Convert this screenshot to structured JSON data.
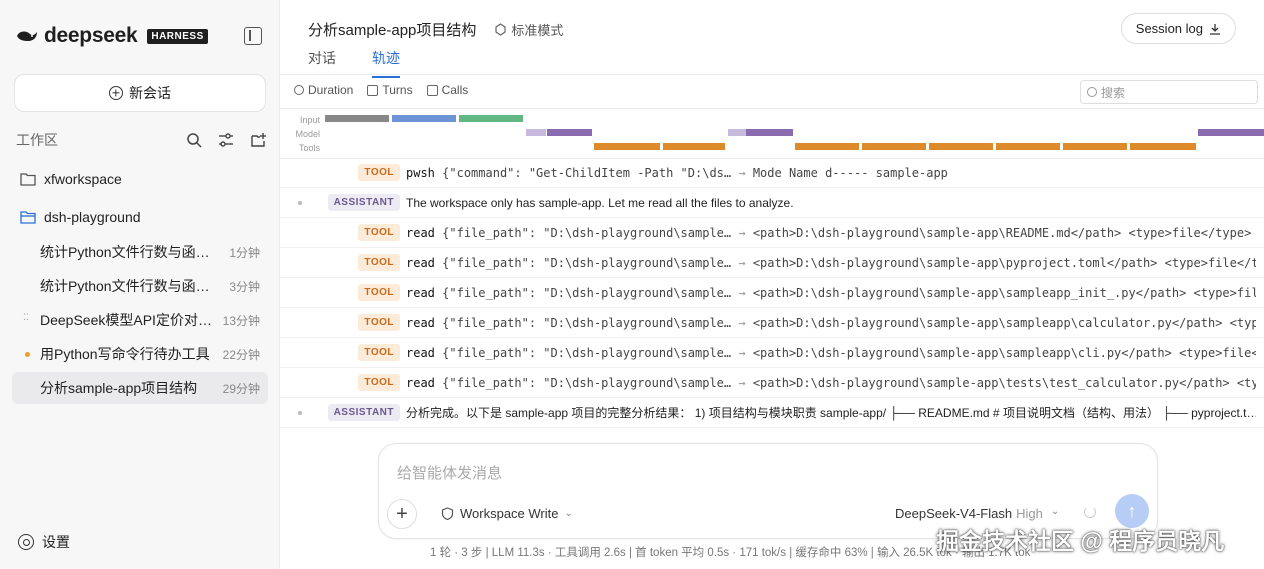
{
  "brand": {
    "name": "deepseek",
    "badge": "HARNESS"
  },
  "sidebar": {
    "new_chat": "新会话",
    "workspace_label": "工作区",
    "folders": [
      "xfworkspace",
      "dsh-playground"
    ],
    "chats": [
      {
        "title": "统计Python文件行数与函数数",
        "time": "1分钟"
      },
      {
        "title": "统计Python文件行数与函数数",
        "time": "3分钟"
      },
      {
        "title": "DeepSeek模型API定价对比...",
        "time": "13分钟"
      },
      {
        "title": "用Python写命令行待办工具",
        "time": "22分钟"
      },
      {
        "title": "分析sample-app项目结构",
        "time": "29分钟"
      }
    ],
    "settings": "设置"
  },
  "header": {
    "title": "分析sample-app项目结构",
    "mode": "标准模式",
    "session_log": "Session log",
    "tabs": [
      "对话",
      "轨迹"
    ]
  },
  "toolbar": {
    "duration": "Duration",
    "turns": "Turns",
    "calls": "Calls",
    "search_placeholder": "搜索"
  },
  "timeline": {
    "lanes": [
      "Input",
      "Model",
      "Tools"
    ]
  },
  "rows": [
    {
      "tag": "TOOL",
      "name": "pwsh",
      "args": "{\"command\": \"Get-ChildItem -Path \"D:\\ds…",
      "result": "Mode Name d----- sample-app"
    },
    {
      "tag": "ASSISTANT",
      "text": "The workspace only has sample-app. Let me read all the files to analyze."
    },
    {
      "tag": "TOOL",
      "name": "read",
      "args": "{\"file_path\": \"D:\\dsh-playground\\sample…",
      "result": "<path>D:\\dsh-playground\\sample-app\\README.md</path> <type>file</type> <content>…"
    },
    {
      "tag": "TOOL",
      "name": "read",
      "args": "{\"file_path\": \"D:\\dsh-playground\\sample…",
      "result": "<path>D:\\dsh-playground\\sample-app\\pyproject.toml</path> <type>file</type> <con…"
    },
    {
      "tag": "TOOL",
      "name": "read",
      "args": "{\"file_path\": \"D:\\dsh-playground\\sample…",
      "result": "<path>D:\\dsh-playground\\sample-app\\sampleapp_init_.py</path> <type>file</type> …"
    },
    {
      "tag": "TOOL",
      "name": "read",
      "args": "{\"file_path\": \"D:\\dsh-playground\\sample…",
      "result": "<path>D:\\dsh-playground\\sample-app\\sampleapp\\calculator.py</path> <type>file</t…"
    },
    {
      "tag": "TOOL",
      "name": "read",
      "args": "{\"file_path\": \"D:\\dsh-playground\\sample…",
      "result": "<path>D:\\dsh-playground\\sample-app\\sampleapp\\cli.py</path> <type>file</type> <c…"
    },
    {
      "tag": "TOOL",
      "name": "read",
      "args": "{\"file_path\": \"D:\\dsh-playground\\sample…",
      "result": "<path>D:\\dsh-playground\\sample-app\\tests\\test_calculator.py</path> <type>file</…"
    },
    {
      "tag": "ASSISTANT",
      "text": "分析完成。以下是 sample-app 项目的完整分析结果： 1) 项目结构与模块职责 sample-app/ ├── README.md # 项目说明文档（结构、用法） ├── pyproject.t…"
    }
  ],
  "composer": {
    "placeholder": "给智能体发消息",
    "permission": "Workspace Write",
    "model": "DeepSeek-V4-Flash",
    "effort": "High"
  },
  "status": "1 轮 · 3 步  |  LLM 11.3s · 工具调用 2.6s  |  首 token 平均 0.5s · 171 tok/s  |  缓存命中 63%  |  输入 26.5K tok · 输出 1.7K tok",
  "watermark": "掘金技术社区 @ 程序员晓凡",
  "colors": {
    "accent": "#2b6fd6",
    "tool_tag": "#c86a1a",
    "assistant_tag": "#6a5a8e",
    "bar_input_gray": "#888888",
    "bar_input_blue": "#6b93d6",
    "bar_input_green": "#62b882",
    "bar_model": "#8a6bb0",
    "bar_tools": "#dd8a2a"
  }
}
